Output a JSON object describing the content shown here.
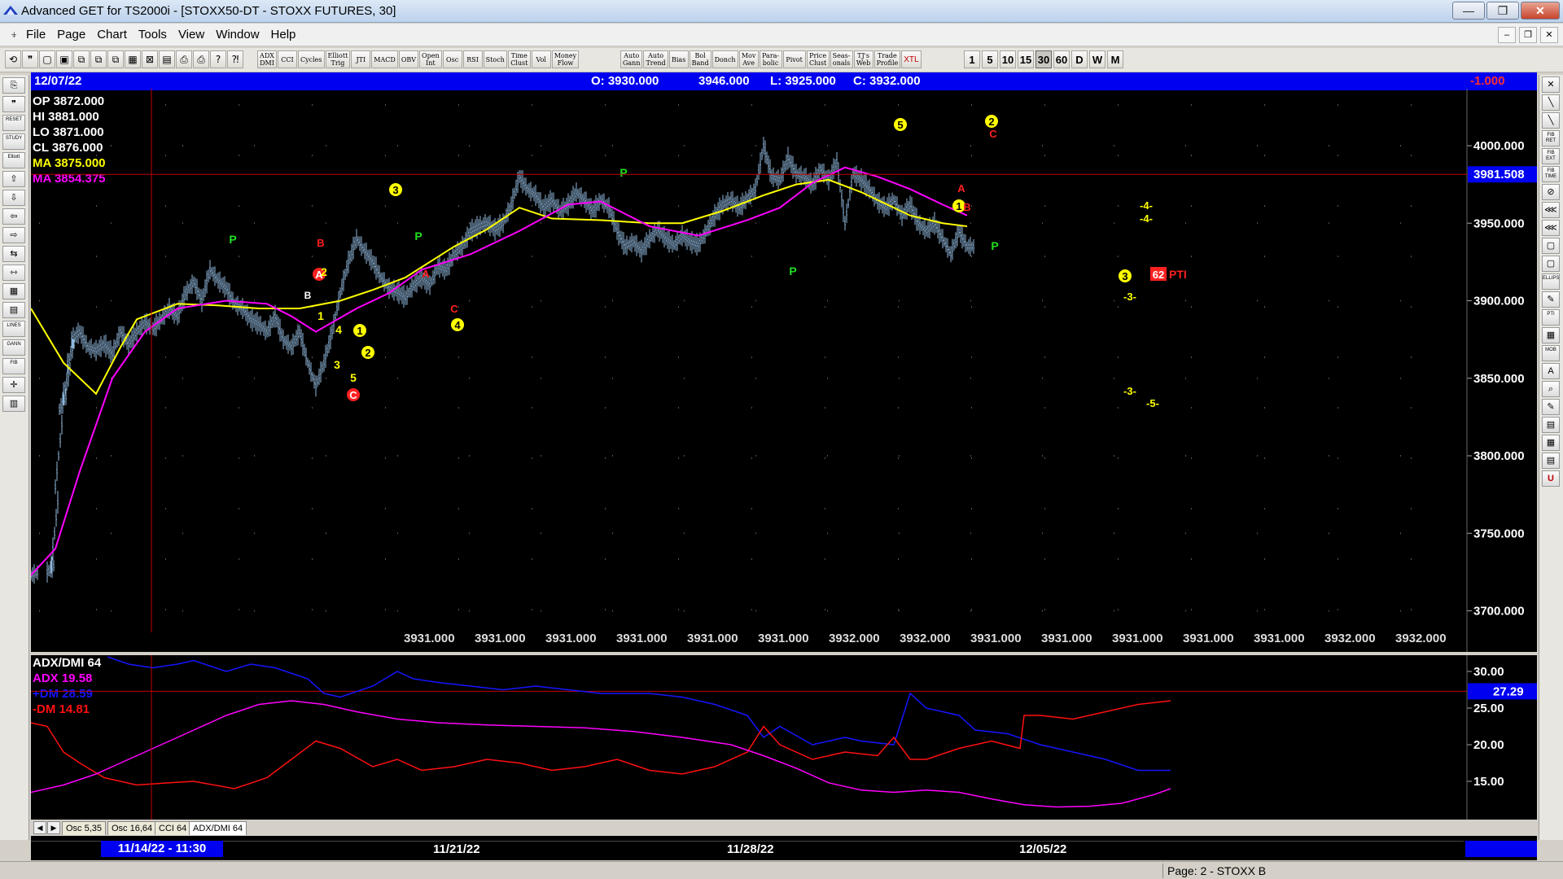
{
  "window": {
    "title": "Advanced GET for TS2000i - [STOXX50-DT - STOXX FUTURES, 30]",
    "buttons": {
      "minimize": "—",
      "maximize": "❐",
      "close": "✕"
    }
  },
  "menu": {
    "items": [
      "File",
      "Page",
      "Chart",
      "Tools",
      "View",
      "Window",
      "Help"
    ],
    "mdi_buttons": [
      "–",
      "❐",
      "✕"
    ]
  },
  "toolbar": {
    "icon_buttons": [
      "⟲",
      "❞",
      "▢",
      "▣",
      "⧉",
      "⧉",
      "⧉",
      "▦",
      "⊠",
      "▤",
      "⎙",
      "⎙",
      "?",
      "⁈"
    ],
    "study_buttons": [
      {
        "l1": "ADX",
        "l2": "DMI"
      },
      {
        "l1": "CCI",
        "l2": ""
      },
      {
        "l1": "Cycles",
        "l2": ""
      },
      {
        "l1": "Elliott",
        "l2": "Trig"
      },
      {
        "l1": "JTI",
        "l2": ""
      },
      {
        "l1": "MACD",
        "l2": ""
      },
      {
        "l1": "OBV",
        "l2": ""
      },
      {
        "l1": "Open",
        "l2": "Int"
      },
      {
        "l1": "Osc",
        "l2": ""
      },
      {
        "l1": "RSI",
        "l2": ""
      },
      {
        "l1": "Stoch",
        "l2": ""
      },
      {
        "l1": "Time",
        "l2": "Clust"
      },
      {
        "l1": "Vol",
        "l2": ""
      },
      {
        "l1": "Money",
        "l2": "Flow"
      }
    ],
    "tool_buttons": [
      {
        "l1": "Auto",
        "l2": "Gann"
      },
      {
        "l1": "Auto",
        "l2": "Trend"
      },
      {
        "l1": "Bias",
        "l2": ""
      },
      {
        "l1": "Bol",
        "l2": "Band"
      },
      {
        "l1": "Donch",
        "l2": ""
      },
      {
        "l1": "Mov",
        "l2": "Ave"
      },
      {
        "l1": "Para-",
        "l2": "bolic"
      },
      {
        "l1": "Pivot",
        "l2": ""
      },
      {
        "l1": "Price",
        "l2": "Clust"
      },
      {
        "l1": "Seas-",
        "l2": "onals"
      },
      {
        "l1": "TJ's",
        "l2": "Web"
      },
      {
        "l1": "Trade",
        "l2": "Profile"
      },
      {
        "l1": "XTL",
        "l2": ""
      }
    ],
    "intervals": [
      "1",
      "5",
      "10",
      "15",
      "30",
      "60",
      "D",
      "W",
      "M"
    ],
    "active_interval": "30"
  },
  "left_tools": [
    "⎘",
    "❞",
    "RESET",
    "STUDY",
    "Elliott",
    "⇧",
    "⇩",
    "⇦",
    "⇨",
    "⇆",
    "⇿",
    "▦",
    "▤",
    "LINES",
    "GANN",
    "FIB",
    "✛",
    "▥"
  ],
  "right_tools": [
    "✕",
    "╲",
    "╲",
    "FIB RET",
    "FIB EXT",
    "FIB TIME",
    "⊘",
    "⋘",
    "⋘",
    "▢",
    "▢",
    "ELLIPS",
    "✎",
    "PTI",
    "▦",
    "MOB",
    "A",
    "⌕",
    "✎",
    "▤",
    "▦",
    "▤",
    "U"
  ],
  "info_bar": {
    "date": "12/07/22",
    "open": "O: 3930.000",
    "high": "3946.000",
    "low": "L: 3925.000",
    "close": "C: 3932.000",
    "change": "-1.000"
  },
  "ohlc_readout": {
    "op": "OP 3872.000",
    "hi": "HI   3881.000",
    "lo": "LO  3871.000",
    "cl": "CL  3876.000",
    "ma1": "MA  3875.000",
    "ma2": "MA  3854.375"
  },
  "price_axis": {
    "ticks": [
      "4000.000",
      "3950.000",
      "3900.000",
      "3850.000",
      "3800.000",
      "3750.000",
      "3700.000"
    ],
    "current_price_label": "3981.508",
    "bottom_readouts": [
      "3931.000",
      "3931.000",
      "3931.000",
      "3931.000",
      "3931.000",
      "3931.000",
      "3932.000",
      "3932.000",
      "3931.000",
      "3931.000",
      "3931.000",
      "3931.000",
      "3931.000",
      "3932.000",
      "3932.000"
    ]
  },
  "colors": {
    "price_bars": "#8fb8dc",
    "ma_fast": "#ffff00",
    "ma_slow": "#ff00ff",
    "adx": "#ff00ff",
    "plus_dm": "#1515ff",
    "minus_dm": "#ff1010",
    "reference_line": "#c00000"
  },
  "elliott_labels": {
    "pivots": [
      "P",
      "P",
      "P",
      "P",
      "P"
    ],
    "yellow_circled": [
      "5",
      "2",
      "1",
      "3",
      "3",
      "1",
      "2",
      "4"
    ],
    "red_circled": [
      "A",
      "C"
    ],
    "red_letters": [
      "B",
      "A",
      "C",
      "A",
      "B",
      "C",
      "B"
    ],
    "yellow_plain": [
      "1",
      "4",
      "3",
      "5",
      "2"
    ],
    "projections": [
      "-4-",
      "-4-",
      "-3-",
      "-3-",
      "-5-"
    ],
    "pti_value": "62",
    "pti_label": "PTI"
  },
  "adx_panel": {
    "title": "ADX/DMI 64",
    "adx": "ADX 19.58",
    "plus_dm": "+DM 28.59",
    "minus_dm": "-DM  14.81",
    "ticks": [
      "30.00",
      "25.00",
      "20.00",
      "15.00"
    ],
    "current_label": "27.29"
  },
  "tabs": [
    "Osc 5,35",
    "Osc 16,64",
    "CCI 64",
    "ADX/DMI 64"
  ],
  "active_tab": "ADX/DMI 64",
  "dates": {
    "cursor_date": "11/14/22 - 11:30",
    "labels": [
      "11/21/22",
      "11/28/22",
      "12/05/22"
    ]
  },
  "status": {
    "page": "Page: 2 - STOXX B"
  }
}
